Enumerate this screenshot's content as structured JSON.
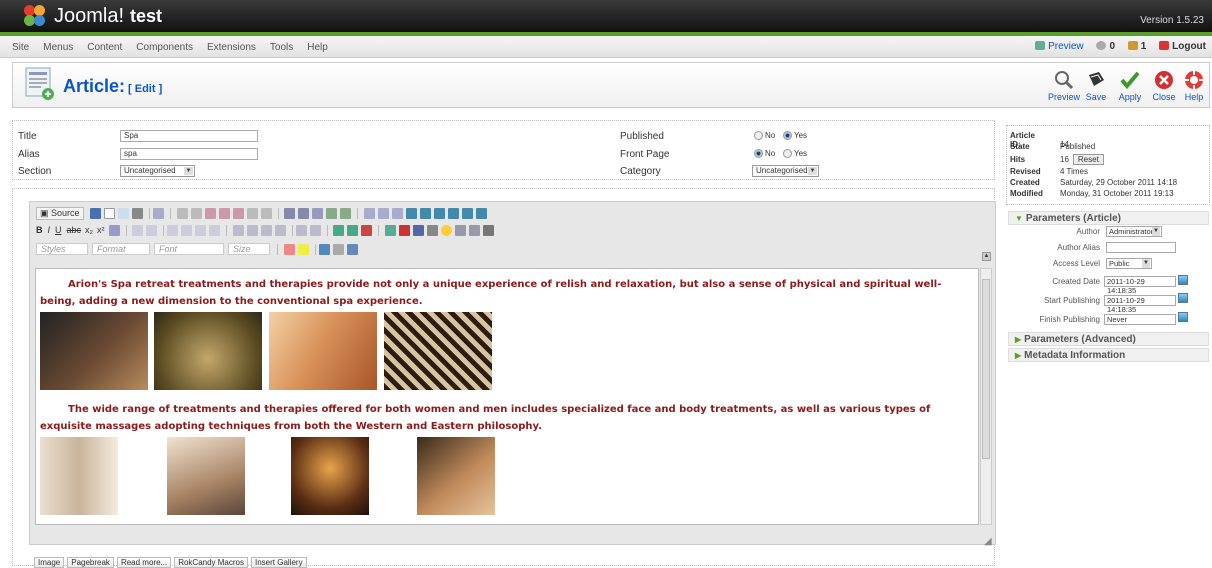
{
  "header": {
    "brand": "Joomla!",
    "site_name": "test",
    "version": "Version 1.5.23"
  },
  "menu": {
    "items": [
      "Site",
      "Menus",
      "Content",
      "Components",
      "Extensions",
      "Tools",
      "Help"
    ],
    "preview": "Preview",
    "visitors": "0",
    "messages": "1",
    "logout": "Logout"
  },
  "toolbar": {
    "title": "Article:",
    "subtitle": "[ Edit ]",
    "buttons": [
      "Preview",
      "Save",
      "Apply",
      "Close",
      "Help"
    ]
  },
  "details": {
    "title_label": "Title",
    "title_value": "Spa",
    "alias_label": "Alias",
    "alias_value": "spa",
    "section_label": "Section",
    "section_value": "Uncategorised",
    "published_label": "Published",
    "frontpage_label": "Front Page",
    "category_label": "Category",
    "category_value": "Uncategorised",
    "no": "No",
    "yes": "Yes"
  },
  "editor": {
    "source": "Source",
    "styles": "Styles",
    "format": "Format",
    "font": "Font",
    "size": "Size",
    "para1": "Arion's Spa retreat treatments and therapies provide not only a unique experience of relish and relaxation, but also a sense of physical and spiritual well-being, adding a new dimension to the conventional spa experience.",
    "para2": "The wide range of treatments and therapies offered for both women and men includes specialized face and body treatments, as well as various types of exquisite massages adopting techniques from both the Western and Eastern philosophy.",
    "buttons": [
      "Image",
      "Pagebreak",
      "Read more...",
      "RokCandy Macros",
      "Insert Gallery"
    ]
  },
  "info": {
    "article_id_label": "Article ID:",
    "article_id": "14",
    "state_label": "State",
    "state": "Published",
    "hits_label": "Hits",
    "hits": "16",
    "reset": "Reset",
    "revised_label": "Revised",
    "revised": "4 Times",
    "created_label": "Created",
    "created": "Saturday, 29 October 2011 14:18",
    "modified_label": "Modified",
    "modified": "Monday, 31 October 2011 19:13"
  },
  "params": {
    "article_header": "Parameters (Article)",
    "author_label": "Author",
    "author": "Administrator",
    "alias_label": "Author Alias",
    "access_label": "Access Level",
    "access": "Public",
    "created_label": "Created Date",
    "created": "2011-10-29 14:18:35",
    "start_label": "Start Publishing",
    "start": "2011-10-29 14:18:35",
    "finish_label": "Finish Publishing",
    "finish": "Never",
    "advanced_header": "Parameters (Advanced)",
    "metadata_header": "Metadata Information"
  },
  "colors": {
    "link": "#0b55c4",
    "accent_green": "#5aa02c",
    "content_text": "#8b1a1a"
  }
}
